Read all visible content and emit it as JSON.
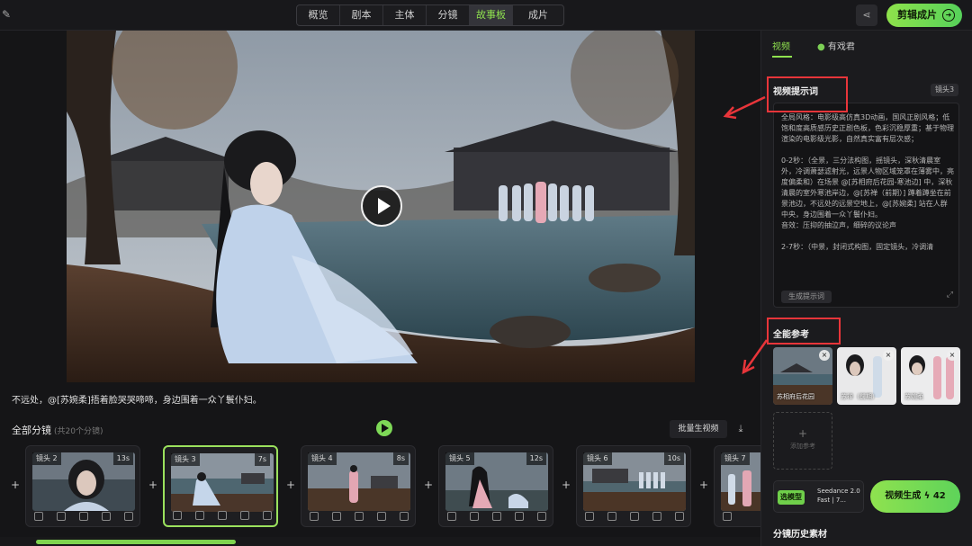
{
  "topbar": {
    "tabs": [
      {
        "label": "概览",
        "active": false
      },
      {
        "label": "剧本",
        "active": false
      },
      {
        "label": "主体",
        "active": false
      },
      {
        "label": "分镜",
        "active": false
      },
      {
        "label": "故事板",
        "active": true
      },
      {
        "label": "成片",
        "active": false
      }
    ],
    "clip_button": "剪辑成片"
  },
  "preview": {
    "caption": "不远处，@[苏婉柔]捂着脸哭哭啼啼，身边围着一众丫鬟仆妇。"
  },
  "storyboard": {
    "title": "全部分镜",
    "count": "(共20个分镜)",
    "batch_button": "批量生视频",
    "shots": [
      {
        "label": "镜头 2",
        "duration": "13s",
        "active": false
      },
      {
        "label": "镜头 3",
        "duration": "7s",
        "active": true
      },
      {
        "label": "镜头 4",
        "duration": "8s",
        "active": false
      },
      {
        "label": "镜头 5",
        "duration": "12s",
        "active": false
      },
      {
        "label": "镜头 6",
        "duration": "10s",
        "active": false
      },
      {
        "label": "镜头 7",
        "duration": "",
        "active": false
      }
    ],
    "plus": "+"
  },
  "panel": {
    "tabs": [
      {
        "label": "视频",
        "active": true
      },
      {
        "label": "有戏君",
        "active": false
      }
    ],
    "prompt_title": "视频提示词",
    "shot_badge": "镜头3",
    "prompt_text": "全局风格：电影级高仿真3D动画，国风正剧风格；低饱和度高质感历史正剧色板，色彩沉稳厚重；基于物理渲染的电影级光影，自然真实富有层次感；\n\n0-2秒：（全景，三分法构图，摇镜头，深秋清晨室外，冷调萧瑟滤射光，远景人物区域笼罩在薄雾中，亮度偏柔和）在场景 @[苏相府后花园-寒池边] 中，深秋清晨的室外寒池岸边，@[苏禅（前期）] 蹲着蹲坐在前景池边，不远处的远景空地上，@[苏婉柔] 站在人群中央，身边围着一众丫鬟仆妇。\n音效：压抑的抽泣声，细碎的议论声\n\n2-7秒：（中景，封闭式构图，固定镜头，冷调清",
    "gen_prompt_button": "生成提示词",
    "ref_title": "全能参考",
    "refs": [
      {
        "label": "苏相府后花园"
      },
      {
        "label": "苏禅（前期）"
      },
      {
        "label": "苏婉柔"
      }
    ],
    "add_ref": "添加参考",
    "model_tag": "选模型",
    "model_name": "Seedance 2.0 Fast | 7...",
    "video_gen_button": "视频生成",
    "video_gen_cost": "42",
    "history_title": "分镜历史素材"
  },
  "colors": {
    "accent": "#8fe24f",
    "annotation": "#e8353a"
  }
}
